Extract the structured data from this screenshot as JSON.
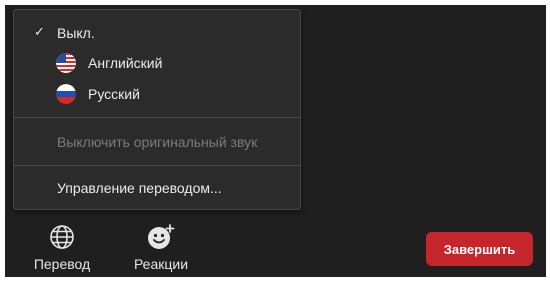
{
  "menu": {
    "items": [
      {
        "label": "Выкл.",
        "checked": true
      },
      {
        "label": "Английский",
        "flag": "us-flag-icon"
      },
      {
        "label": "Русский",
        "flag": "ru-flag-icon"
      }
    ],
    "mute_original": {
      "label": "Выключить оригинальный звук",
      "disabled": true
    },
    "manage": {
      "label": "Управление переводом..."
    }
  },
  "toolbar": {
    "translate": {
      "label": "Перевод",
      "icon": "globe-icon"
    },
    "reactions": {
      "label": "Реакции",
      "icon": "emoji-add-icon"
    },
    "end": {
      "label": "Завершить",
      "color": "#c6262b"
    }
  },
  "colors": {
    "background": "#1f1f1f",
    "menu_background": "#2b2b2b",
    "disabled_text": "#7b7b7b",
    "end_button": "#c6262b"
  }
}
